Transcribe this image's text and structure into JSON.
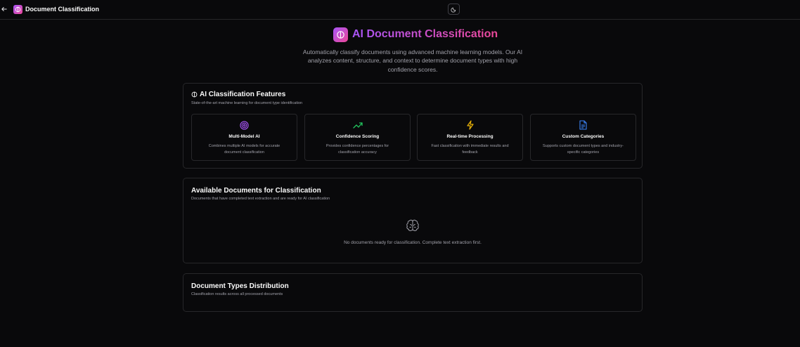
{
  "header": {
    "back_icon": "arrow-left-icon",
    "app_icon": "brain-icon",
    "title": "Document Classification",
    "theme_icon": "moon-icon"
  },
  "hero": {
    "icon": "brain-icon",
    "title": "AI Document Classification",
    "description": "Automatically classify documents using advanced machine learning models. Our AI analyzes content, structure, and context to determine document types with high confidence scores."
  },
  "features_card": {
    "icon": "brain-icon",
    "title": "AI Classification Features",
    "subtitle": "State-of-the-art machine learning for document type identification",
    "features": [
      {
        "icon": "target-icon",
        "color": "#a855f7",
        "title": "Multi-Model AI",
        "description": "Combines multiple AI models for accurate document classification"
      },
      {
        "icon": "trending-up-icon",
        "color": "#22c55e",
        "title": "Confidence Scoring",
        "description": "Provides confidence percentages for classification accuracy"
      },
      {
        "icon": "zap-icon",
        "color": "#eab308",
        "title": "Real-time Processing",
        "description": "Fast classification with immediate results and feedback"
      },
      {
        "icon": "file-text-icon",
        "color": "#3b82f6",
        "title": "Custom Categories",
        "description": "Supports custom document types and industry-specific categories"
      }
    ]
  },
  "available_card": {
    "title": "Available Documents for Classification",
    "subtitle": "Documents that have completed text extraction and are ready for AI classification",
    "empty_icon": "brain-icon",
    "empty_text": "No documents ready for classification. Complete text extraction first."
  },
  "distribution_card": {
    "title": "Document Types Distribution",
    "subtitle": "Classification results across all processed documents"
  }
}
